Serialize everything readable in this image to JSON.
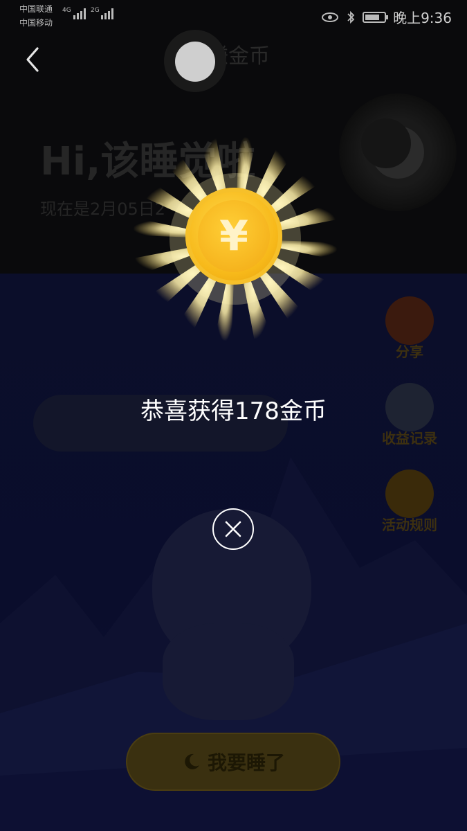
{
  "status_bar": {
    "carrier_1": "中国联通",
    "carrier_2": "中国移动",
    "net_1": "4G",
    "net_2": "2G",
    "time": "晚上9:36"
  },
  "header": {
    "title": "赚金币"
  },
  "greeting": {
    "title": "Hi,该睡觉啦",
    "date": "现在是2月05日2"
  },
  "side_buttons": [
    {
      "label": "分享",
      "color": "#3b1a0e"
    },
    {
      "label": "收益记录",
      "color": "#1e2332"
    },
    {
      "label": "活动规则",
      "color": "#3a2a0a"
    }
  ],
  "bottom_button": {
    "label": "我要睡了"
  },
  "reward": {
    "message": "恭喜获得178金币",
    "coin_symbol": "¥"
  },
  "colors": {
    "coin": "#f7b91a",
    "overlay_text": "#ffffff"
  }
}
